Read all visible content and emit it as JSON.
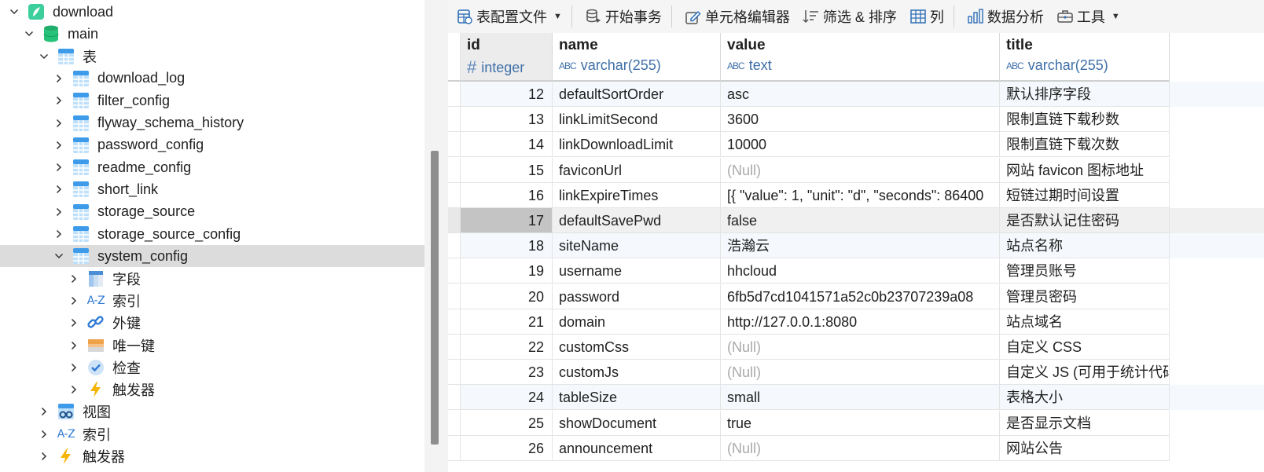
{
  "tree": {
    "items": [
      {
        "label": "download",
        "icon": "connection-icon",
        "indent": 0,
        "chevron": "down"
      },
      {
        "label": "main",
        "icon": "database-icon",
        "indent": 1,
        "chevron": "down"
      },
      {
        "label": "表",
        "icon": "table-icon",
        "indent": 2,
        "chevron": "down"
      },
      {
        "label": "download_log",
        "icon": "table-icon",
        "indent": 3,
        "chevron": "right"
      },
      {
        "label": "filter_config",
        "icon": "table-icon",
        "indent": 3,
        "chevron": "right"
      },
      {
        "label": "flyway_schema_history",
        "icon": "table-icon",
        "indent": 3,
        "chevron": "right"
      },
      {
        "label": "password_config",
        "icon": "table-icon",
        "indent": 3,
        "chevron": "right"
      },
      {
        "label": "readme_config",
        "icon": "table-icon",
        "indent": 3,
        "chevron": "right"
      },
      {
        "label": "short_link",
        "icon": "table-icon",
        "indent": 3,
        "chevron": "right"
      },
      {
        "label": "storage_source",
        "icon": "table-icon",
        "indent": 3,
        "chevron": "right"
      },
      {
        "label": "storage_source_config",
        "icon": "table-icon",
        "indent": 3,
        "chevron": "right"
      },
      {
        "label": "system_config",
        "icon": "table-icon",
        "indent": 3,
        "chevron": "down",
        "selected": true
      },
      {
        "label": "字段",
        "icon": "fields-icon",
        "indent": 4,
        "chevron": "right"
      },
      {
        "label": "索引",
        "icon": "index-icon",
        "indent": 4,
        "chevron": "right"
      },
      {
        "label": "外键",
        "icon": "foreign-key-icon",
        "indent": 4,
        "chevron": "right"
      },
      {
        "label": "唯一键",
        "icon": "unique-key-icon",
        "indent": 4,
        "chevron": "right"
      },
      {
        "label": "检查",
        "icon": "check-icon",
        "indent": 4,
        "chevron": "right"
      },
      {
        "label": "触发器",
        "icon": "trigger-icon",
        "indent": 4,
        "chevron": "right"
      },
      {
        "label": "视图",
        "icon": "view-icon",
        "indent": 2,
        "chevron": "right"
      },
      {
        "label": "索引",
        "icon": "index-icon",
        "indent": 2,
        "chevron": "right"
      },
      {
        "label": "触发器",
        "icon": "trigger-icon",
        "indent": 2,
        "chevron": "right"
      }
    ]
  },
  "toolbar": {
    "table_config_file": "表配置文件",
    "begin_transaction": "开始事务",
    "cell_editor": "单元格编辑器",
    "filter_sort": "筛选 & 排序",
    "columns": "列",
    "data_analysis": "数据分析",
    "tools": "工具"
  },
  "grid": {
    "columns": [
      {
        "name": "id",
        "type": "integer"
      },
      {
        "name": "name",
        "type": "varchar(255)"
      },
      {
        "name": "value",
        "type": "text"
      },
      {
        "name": "title",
        "type": "varchar(255)"
      }
    ],
    "type_glyph": "ABC",
    "null_text": "(Null)",
    "rows": [
      {
        "id": "12",
        "name": "defaultSortOrder",
        "value": "asc",
        "title": "默认排序字段"
      },
      {
        "id": "13",
        "name": "linkLimitSecond",
        "value": "3600",
        "title": "限制直链下载秒数"
      },
      {
        "id": "14",
        "name": "linkDownloadLimit",
        "value": "10000",
        "title": "限制直链下载次数"
      },
      {
        "id": "15",
        "name": "faviconUrl",
        "value": null,
        "title": "网站 favicon 图标地址"
      },
      {
        "id": "16",
        "name": "linkExpireTimes",
        "value": "[{ \"value\": 1, \"unit\": \"d\", \"seconds\": 86400",
        "title": "短链过期时间设置"
      },
      {
        "id": "17",
        "name": "defaultSavePwd",
        "value": "false",
        "title": "是否默认记住密码",
        "selected": true
      },
      {
        "id": "18",
        "name": "siteName",
        "value": "浩瀚云",
        "title": "站点名称"
      },
      {
        "id": "19",
        "name": "username",
        "value": "hhcloud",
        "title": "管理员账号"
      },
      {
        "id": "20",
        "name": "password",
        "value": "6fb5d7cd1041571a52c0b23707239a08",
        "title": "管理员密码"
      },
      {
        "id": "21",
        "name": "domain",
        "value": "http://127.0.0.1:8080",
        "title": "站点域名"
      },
      {
        "id": "22",
        "name": "customCss",
        "value": null,
        "title": "自定义 CSS"
      },
      {
        "id": "23",
        "name": "customJs",
        "value": null,
        "title": "自定义 JS (可用于统计代码"
      },
      {
        "id": "24",
        "name": "tableSize",
        "value": "small",
        "title": "表格大小"
      },
      {
        "id": "25",
        "name": "showDocument",
        "value": "true",
        "title": "是否显示文档"
      },
      {
        "id": "26",
        "name": "announcement",
        "value": null,
        "title": "网站公告"
      }
    ]
  },
  "colors": {
    "selected_tree_row": "#dcdcdc",
    "selected_grid_row": "#f0f0f0",
    "alt_row": "#f5f9fd",
    "type_text": "#3f6fa8",
    "null_text": "#a9a9a9"
  }
}
